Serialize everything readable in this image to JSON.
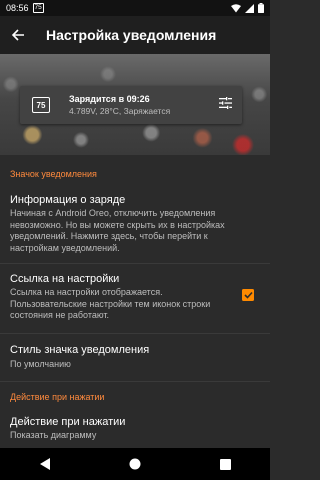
{
  "statusbar": {
    "time": "08:56",
    "notif_badge": "75"
  },
  "appbar": {
    "title": "Настройка уведомления"
  },
  "preview": {
    "badge": "75",
    "line1": "Зарядится в 09:26",
    "line2": "4.789V, 28°C, Заряжается"
  },
  "sections": {
    "icon_header": "Значок уведомления",
    "tap_header": "Действие при нажатии"
  },
  "prefs": {
    "charge_info": {
      "title": "Информация о заряде",
      "summary": "Начиная с Android Oreo, отключить уведомления невозможно. Но вы можете скрыть их в настройках уведомлений. Нажмите здесь, чтобы перейти к настройкам уведомлений."
    },
    "settings_link": {
      "title": "Ссылка на настройки",
      "summary": "Ссылка на настройки отображается. Пользовательские настройки тем иконок строки состояния не работают.",
      "checked": true
    },
    "icon_style": {
      "title": "Стиль значка уведомления",
      "summary": "По умолчанию"
    },
    "tap_action": {
      "title": "Действие при нажатии",
      "summary": "Показать диаграмму"
    }
  },
  "colors": {
    "accent": "#ff8a3d",
    "checkbox": "#ff8a00",
    "background": "#2b2b2b"
  }
}
